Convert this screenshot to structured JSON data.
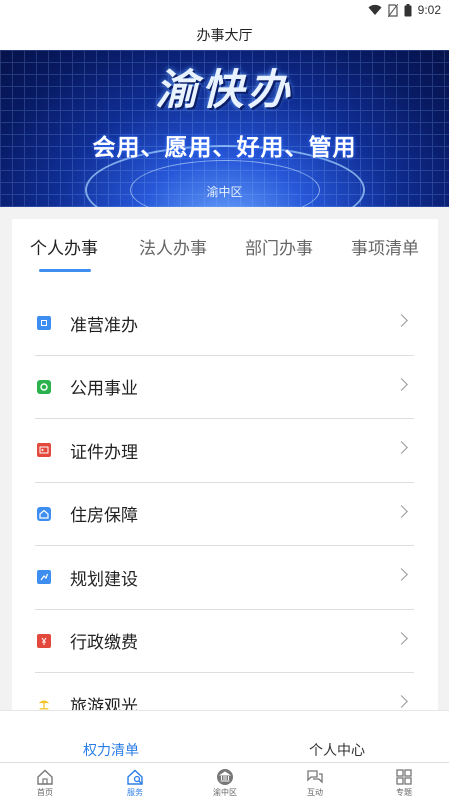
{
  "status": {
    "time": "9:02"
  },
  "header": {
    "title": "办事大厅"
  },
  "banner": {
    "logo_text": "渝快办",
    "slogan": "会用、愿用、好用、管用",
    "district": "渝中区"
  },
  "tabs": [
    {
      "label": "个人办事",
      "active": true
    },
    {
      "label": "法人办事",
      "active": false
    },
    {
      "label": "部门办事",
      "active": false
    },
    {
      "label": "事项清单",
      "active": false
    }
  ],
  "items": [
    {
      "label": "准营准办",
      "icon": "license-icon",
      "color": "#3d8ef0"
    },
    {
      "label": "公用事业",
      "icon": "utility-icon",
      "color": "#2bb24c"
    },
    {
      "label": "证件办理",
      "icon": "id-card-icon",
      "color": "#e2483b"
    },
    {
      "label": "住房保障",
      "icon": "house-icon",
      "color": "#3d8ef0"
    },
    {
      "label": "规划建设",
      "icon": "planning-icon",
      "color": "#3d8ef0"
    },
    {
      "label": "行政缴费",
      "icon": "payment-icon",
      "color": "#e2483b"
    },
    {
      "label": "旅游观光",
      "icon": "tourism-icon",
      "color": "#f3c22b"
    }
  ],
  "subtabs": {
    "left": "权力清单",
    "right": "个人中心"
  },
  "nav": [
    {
      "label": "首页",
      "icon": "home-icon",
      "active": false
    },
    {
      "label": "服务",
      "icon": "service-icon",
      "active": true
    },
    {
      "label": "渝中区",
      "icon": "bank-icon",
      "active": false
    },
    {
      "label": "互动",
      "icon": "interaction-icon",
      "active": false
    },
    {
      "label": "专题",
      "icon": "topics-icon",
      "active": false
    }
  ],
  "colors": {
    "accent": "#2b7ee6",
    "banner": "#0f2d93"
  }
}
